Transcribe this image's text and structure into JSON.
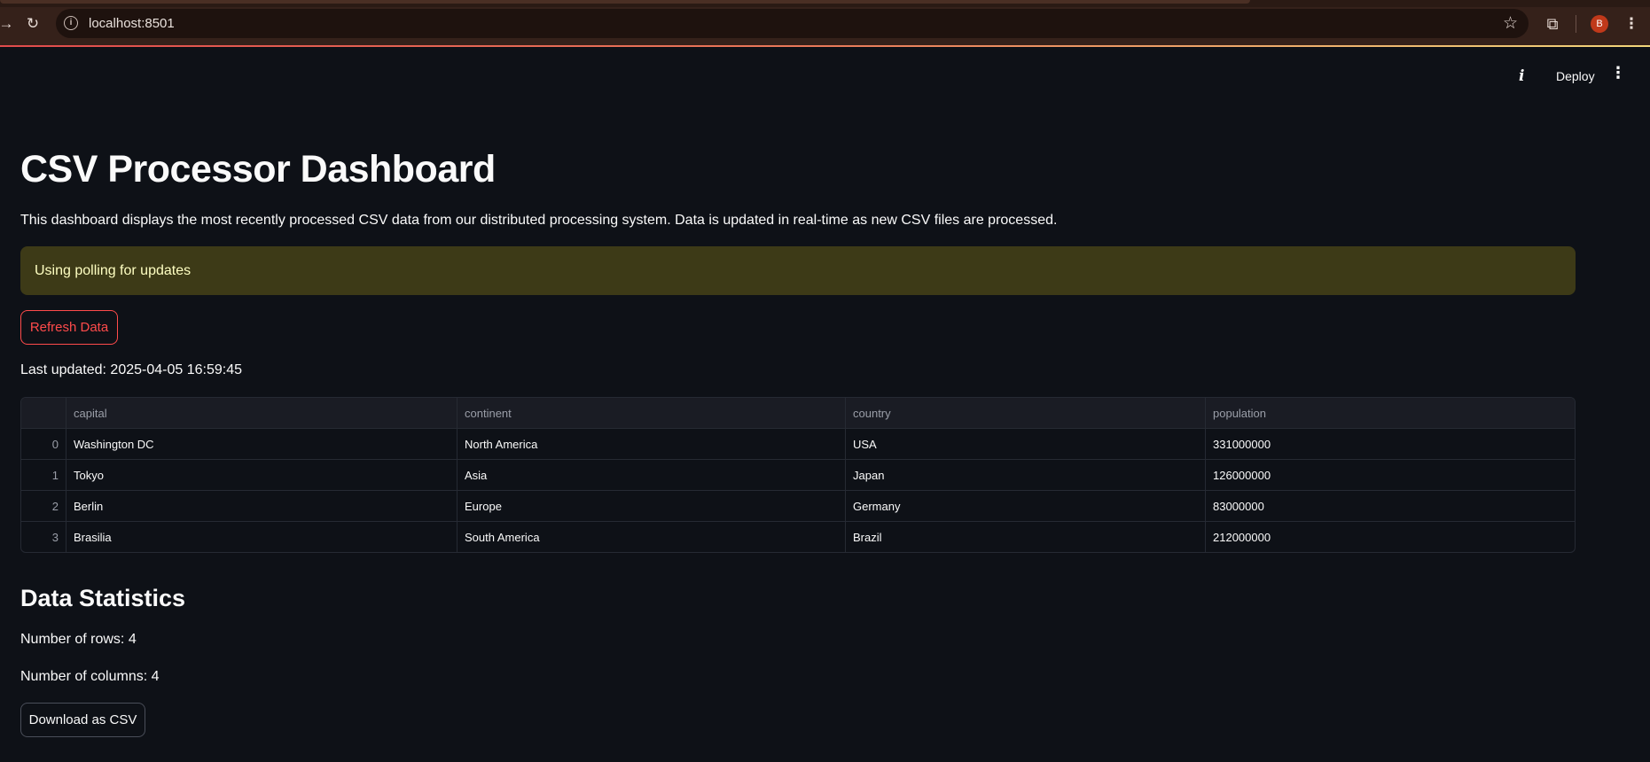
{
  "browser": {
    "url": "localhost:8501",
    "profile_initial": "B",
    "icons": [
      "back-icon",
      "reload-icon",
      "site-info-icon",
      "bookmark-star-icon",
      "extensions-icon",
      "browser-menu-icon"
    ]
  },
  "header": {
    "info_label": "i",
    "deploy_label": "Deploy",
    "menu_label": "⋮"
  },
  "page": {
    "title": "CSV Processor Dashboard",
    "description": "This dashboard displays the most recently processed CSV data from our distributed processing system. Data is updated in real-time as new CSV files are processed.",
    "alert": "Using polling for updates",
    "refresh_label": "Refresh Data",
    "last_updated": "Last updated: 2025-04-05 16:59:45"
  },
  "table": {
    "columns": [
      "capital",
      "continent",
      "country",
      "population"
    ],
    "rows": [
      {
        "index": "0",
        "capital": "Washington DC",
        "continent": "North America",
        "country": "USA",
        "population": "331000000"
      },
      {
        "index": "1",
        "capital": "Tokyo",
        "continent": "Asia",
        "country": "Japan",
        "population": "126000000"
      },
      {
        "index": "2",
        "capital": "Berlin",
        "continent": "Europe",
        "country": "Germany",
        "population": "83000000"
      },
      {
        "index": "3",
        "capital": "Brasilia",
        "continent": "South America",
        "country": "Brazil",
        "population": "212000000"
      }
    ]
  },
  "stats": {
    "title": "Data Statistics",
    "rows_text": "Number of rows: 4",
    "columns_text": "Number of columns: 4",
    "download_label": "Download as CSV"
  },
  "colors": {
    "background": "#0e1117",
    "accent": "#ff4b4b",
    "alert_bg": "#3d3a17",
    "alert_text": "#ffffc2"
  }
}
